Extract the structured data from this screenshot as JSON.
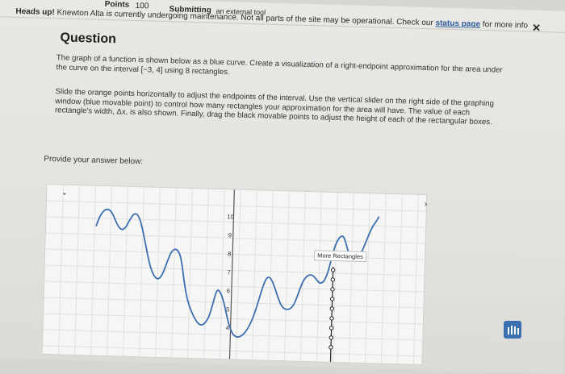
{
  "topbar": {
    "points_label": "Points",
    "points_value": "100",
    "submitting_label": "Submitting",
    "submitting_value": "an external tool"
  },
  "banner": {
    "heading": "Heads up!",
    "text": "Knewton Alta is currently undergoing maintenance. Not all parts of the site may be operational. Check our",
    "link": "status page",
    "suffix": "for more info",
    "close_icon": "close-icon"
  },
  "question": {
    "title": "Question",
    "p1": "The graph of a function is shown below as a blue curve. Create a visualization of a right-endpoint approximation for the area under the curve on the interval [−3, 4] using 8 rectangles.",
    "p2": "Slide the orange points horizontally to adjust the endpoints of the interval. Use the vertical slider on the right side of the graphing window (blue movable point) to control how many rectangles your approximation for the area will have. The value of each rectangle's width, Δx, is also shown. Finally, drag the black movable points to adjust the height of each of the rectangular boxes.",
    "prompt": "Provide your answer below:"
  },
  "graph": {
    "y_ticks": [
      "10",
      "9",
      "8",
      "7",
      "6",
      "5",
      "4"
    ],
    "more_rectangles_label": "More Rectangles",
    "expand_icon": "chevron-down-icon",
    "collapse_icon": "chevron-right-icon"
  },
  "colors": {
    "curve": "#3b6fb0",
    "banner_link": "#2a5a9a",
    "corner_button": "#3b6fb0"
  }
}
